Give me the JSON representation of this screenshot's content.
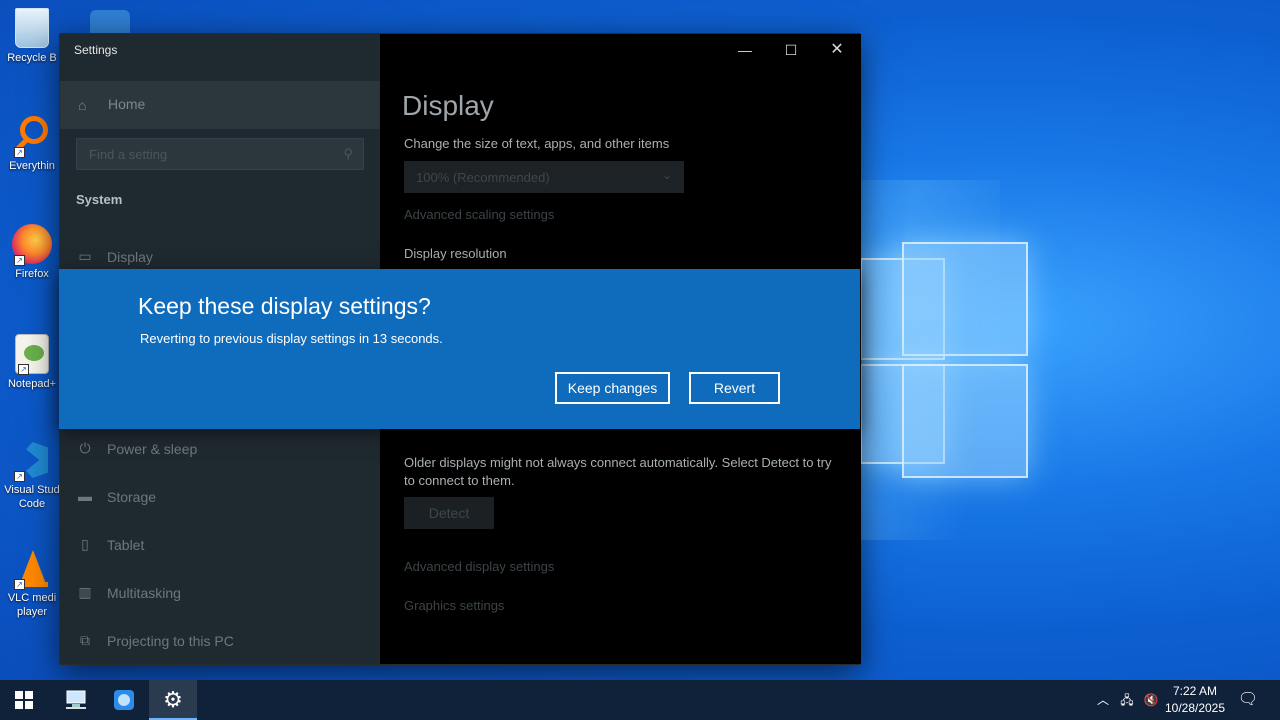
{
  "desktop": {
    "icons": [
      {
        "label": "Recycle B",
        "icon": "recycle-bin-icon"
      },
      {
        "label": "Everythin",
        "icon": "magnifier-icon"
      },
      {
        "label": "Firefox",
        "icon": "firefox-icon"
      },
      {
        "label": "Notepad+",
        "icon": "notepad-plus-icon"
      },
      {
        "label": "Visual Stud Code",
        "icon": "vscode-icon"
      },
      {
        "label": "VLC medi player",
        "icon": "vlc-icon"
      }
    ]
  },
  "settings": {
    "window_title": "Settings",
    "home_label": "Home",
    "search_placeholder": "Find a setting",
    "section_heading": "System",
    "nav_items": [
      {
        "label": "Display",
        "icon": "monitor-icon"
      },
      {
        "label": "Power & sleep",
        "icon": "power-icon"
      },
      {
        "label": "Storage",
        "icon": "storage-icon"
      },
      {
        "label": "Tablet",
        "icon": "tablet-icon"
      },
      {
        "label": "Multitasking",
        "icon": "multitasking-icon"
      },
      {
        "label": "Projecting to this PC",
        "icon": "projecting-icon"
      }
    ],
    "content": {
      "title": "Display",
      "scale_label": "Change the size of text, apps, and other items",
      "scale_value": "100% (Recommended)",
      "advanced_scaling_link": "Advanced scaling settings",
      "resolution_label": "Display resolution",
      "detect_text": "Older displays might not always connect automatically. Select Detect to try to connect to them.",
      "detect_button": "Detect",
      "advanced_display_link": "Advanced display settings",
      "graphics_link": "Graphics settings"
    }
  },
  "dialog": {
    "title": "Keep these display settings?",
    "message": "Reverting to previous display settings in 13 seconds.",
    "keep_label": "Keep changes",
    "revert_label": "Revert"
  },
  "taskbar": {
    "time": "7:22 AM",
    "date": "10/28/2025"
  },
  "colors": {
    "dialog_bg": "#0f6cbd",
    "taskbar_bg": "#10223a",
    "sidebar_bg": "#1f2a30"
  }
}
